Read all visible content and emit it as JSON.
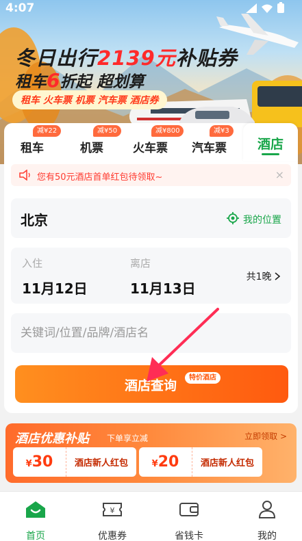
{
  "status_bar": {
    "time": "4:07"
  },
  "hero": {
    "title_prefix": "冬日出行",
    "title_amount": "2139元",
    "title_suffix": "补贴券",
    "line2_prefix": "租车",
    "line2_discount": "6",
    "line2_suffix": "折起 超划算",
    "tag": "租车 火车票 机票 汽车票 酒店券"
  },
  "tabs": [
    {
      "label": "租车",
      "badge": "减¥22"
    },
    {
      "label": "机票",
      "badge": "减¥50"
    },
    {
      "label": "火车票",
      "badge": "减¥800"
    },
    {
      "label": "汽车票",
      "badge": "减¥3"
    },
    {
      "label": "酒店",
      "badge": ""
    }
  ],
  "notice": {
    "text": "您有50元酒店首单红包待领取~",
    "close": "×"
  },
  "location": {
    "city": "北京",
    "my_location": "我的位置"
  },
  "dates": {
    "checkin_label": "入住",
    "checkin": "11月12日",
    "checkout_label": "离店",
    "checkout": "11月13日",
    "nights": "共1晚"
  },
  "keyword": {
    "placeholder": "关键词/位置/品牌/酒店名"
  },
  "search": {
    "label": "酒店查询",
    "tag": "特价酒店"
  },
  "promo": {
    "title": "酒店优惠补贴",
    "subtitle": "下单享立减",
    "link": "立即领取 >",
    "coupons": [
      {
        "currency": "¥",
        "amount": "30",
        "name": "酒店新人红包"
      },
      {
        "currency": "¥",
        "amount": "20",
        "name": "酒店新人红包"
      }
    ]
  },
  "bottom_nav": [
    {
      "label": "首页"
    },
    {
      "label": "优惠券"
    },
    {
      "label": "省钱卡"
    },
    {
      "label": "我的"
    }
  ],
  "colors": {
    "accent": "#19a64a",
    "orange": "#ff5a0f",
    "red": "#ff3b30"
  }
}
